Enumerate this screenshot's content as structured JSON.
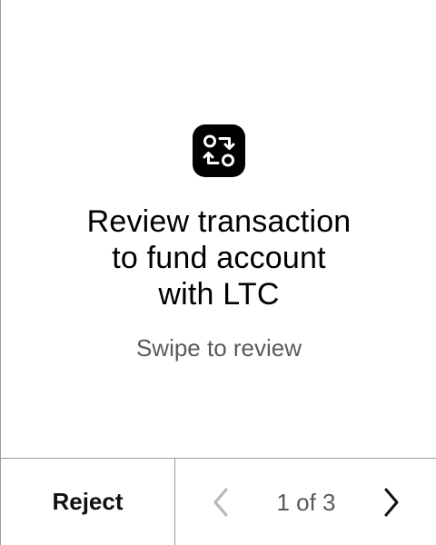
{
  "screen": {
    "icon": "swap-arrows-icon",
    "title_lines": [
      "Review transaction",
      "to fund account",
      "with LTC"
    ],
    "subtitle": "Swipe to review"
  },
  "footer": {
    "reject_label": "Reject",
    "pager": {
      "label": "1 of 3",
      "current": 1,
      "total": 3,
      "prev_icon": "chevron-left-icon",
      "next_icon": "chevron-right-icon"
    }
  },
  "colors": {
    "background": "#ffffff",
    "text": "#000000",
    "muted_text": "#5a5a5a",
    "divider": "#9a9a9a",
    "icon_bg": "#000000",
    "disabled_chevron": "#b5b5b5"
  }
}
